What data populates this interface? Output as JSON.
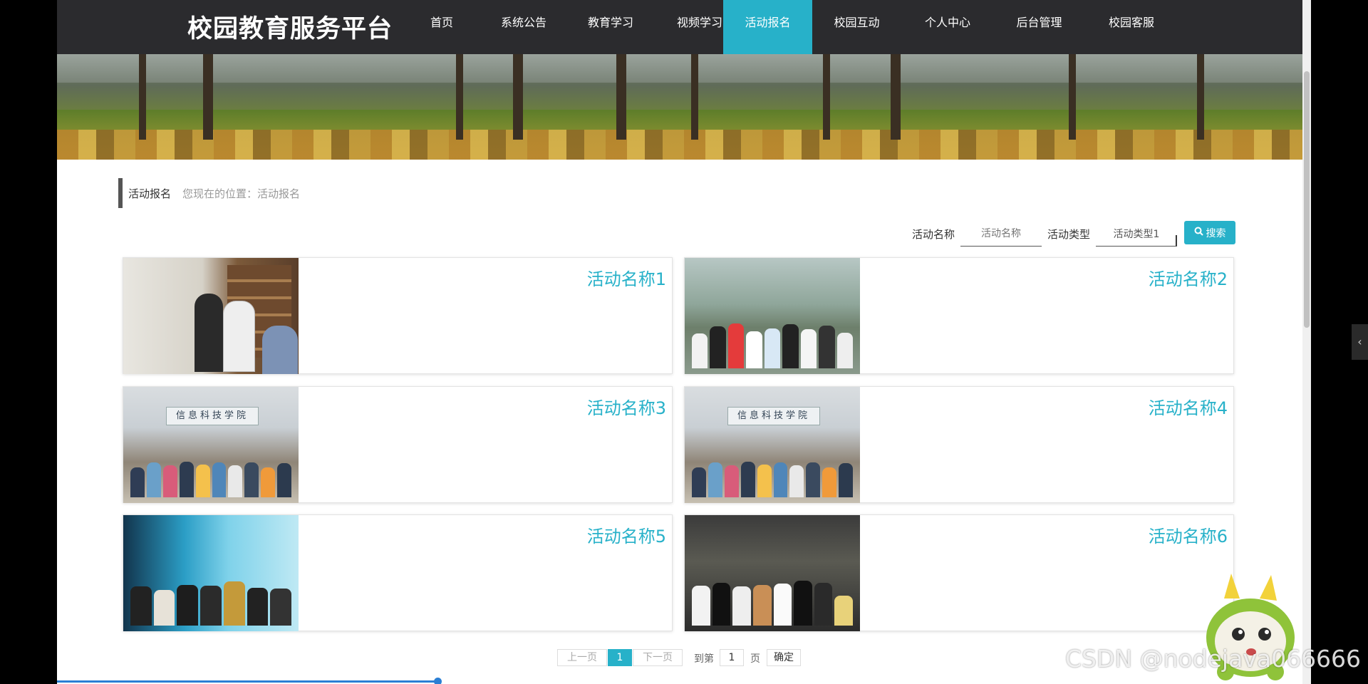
{
  "site": {
    "title": "校园教育服务平台"
  },
  "nav": {
    "items": [
      {
        "label": "首页"
      },
      {
        "label": "系统公告"
      },
      {
        "label": "教育学习"
      },
      {
        "label": "视频学习"
      },
      {
        "label": "活动报名",
        "active": true
      },
      {
        "label": "校园互动"
      },
      {
        "label": "个人中心"
      },
      {
        "label": "后台管理"
      },
      {
        "label": "校园客服"
      }
    ]
  },
  "breadcrumb": {
    "title": "活动报名",
    "path": "您现在的位置：活动报名"
  },
  "search": {
    "name_label": "活动名称",
    "name_placeholder": "活动名称",
    "type_label": "活动类型",
    "type_value": "活动类型1",
    "button_label": "搜索"
  },
  "activities": [
    {
      "name": "活动名称1"
    },
    {
      "name": "活动名称2"
    },
    {
      "name": "活动名称3"
    },
    {
      "name": "活动名称4"
    },
    {
      "name": "活动名称5"
    },
    {
      "name": "活动名称6"
    }
  ],
  "photo_signs": {
    "hall_sign": "信息科技学院"
  },
  "pagination": {
    "prev_label": "上一页",
    "current_page": "1",
    "next_label": "下一页",
    "goto_label": "到第",
    "goto_value": "1",
    "page_suffix": "页",
    "confirm_label": "确定"
  },
  "watermark": "CSDN @nodejava066666",
  "colors": {
    "accent": "#27b1c9",
    "nav_bg": "#2b2b2e"
  }
}
